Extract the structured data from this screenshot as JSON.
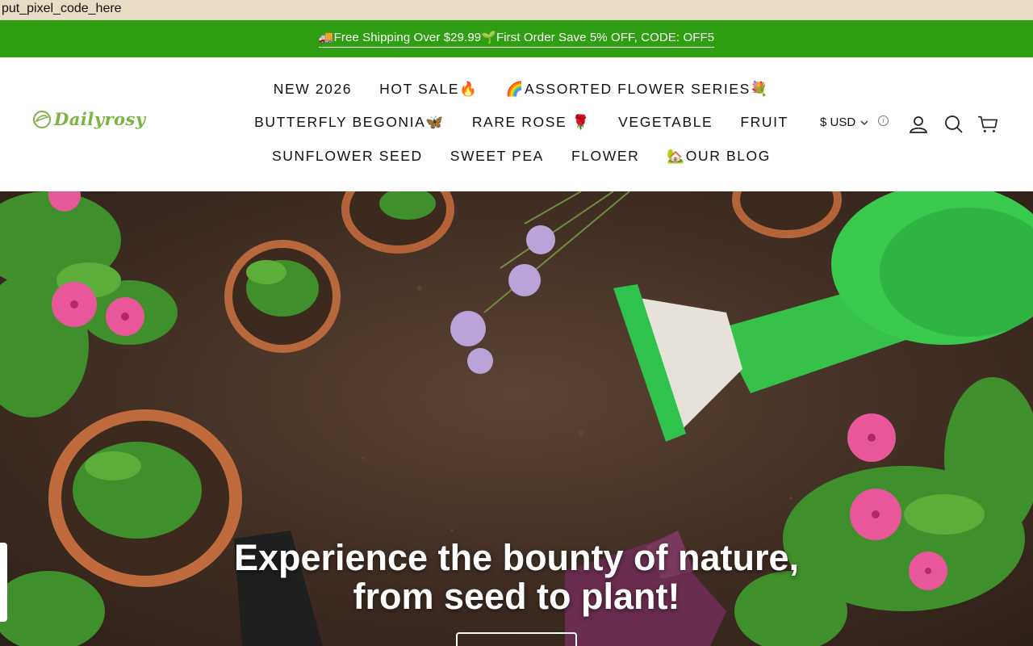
{
  "debug_text": "put_pixel_code_here",
  "announcement": "🚚Free Shipping Over $29.99🌱First Order Save 5% OFF, CODE: OFF5",
  "logo": {
    "text": "Dailyrosy"
  },
  "nav": {
    "row1": [
      "NEW 2026",
      "HOT SALE🔥",
      "🌈ASSORTED FLOWER SERIES💐"
    ],
    "row2": [
      "BUTTERFLY BEGONIA🦋",
      "RARE ROSE 🌹",
      "VEGETABLE",
      "FRUIT"
    ],
    "row3": [
      "SUNFLOWER SEED",
      "SWEET PEA",
      "FLOWER",
      "🏡OUR BLOG"
    ]
  },
  "currency": {
    "label": "$ USD"
  },
  "icons": {
    "account": "account-icon",
    "search": "search-icon",
    "cart": "cart-icon",
    "info": "info-icon",
    "chevron": "chevron-down-icon"
  },
  "hero": {
    "title_line1": "Experience the bounty of nature,",
    "title_line2": "from seed to plant!"
  },
  "colors": {
    "announce_bg": "#2f9e12",
    "logo_green": "#7cb342",
    "soil": "#4a3528"
  }
}
